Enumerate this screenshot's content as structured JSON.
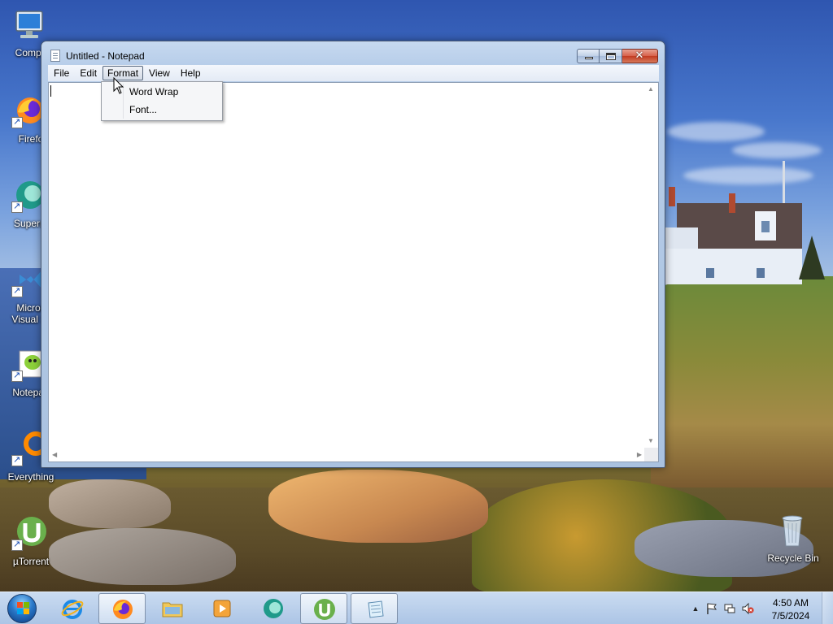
{
  "window": {
    "title": "Untitled - Notepad",
    "close_glyph": "✕"
  },
  "menubar": {
    "items": [
      "File",
      "Edit",
      "Format",
      "View",
      "Help"
    ],
    "active": "Format"
  },
  "dropdown": {
    "items": [
      "Word Wrap",
      "Font..."
    ]
  },
  "desktop_icons": [
    {
      "label": "Compu",
      "icon": "computer-icon"
    },
    {
      "label": "Firefo",
      "icon": "firefox-icon"
    },
    {
      "label": "Superm",
      "icon": "supermium-icon"
    },
    {
      "label": "Micros Visual St",
      "icon": "visual-studio-icon"
    },
    {
      "label": "Notepad",
      "icon": "notepad-plus-icon"
    },
    {
      "label": "Everything",
      "icon": "everything-search-icon"
    },
    {
      "label": "µTorrent",
      "icon": "utorrent-icon"
    },
    {
      "label": "Recycle Bin",
      "icon": "recycle-bin-icon"
    }
  ],
  "taskbar": {
    "pinned": [
      "internet-explorer-icon",
      "firefox-icon",
      "file-explorer-icon",
      "media-player-icon",
      "supermium-icon",
      "utorrent-icon",
      "notepad-icon"
    ],
    "clock_time": "4:50 AM",
    "clock_date": "7/5/2024",
    "tray_expand_glyph": "▲"
  },
  "colors": {
    "accent": "#2a78c8",
    "close_button": "#c23c22",
    "utorrent_green": "#6ab04c"
  }
}
